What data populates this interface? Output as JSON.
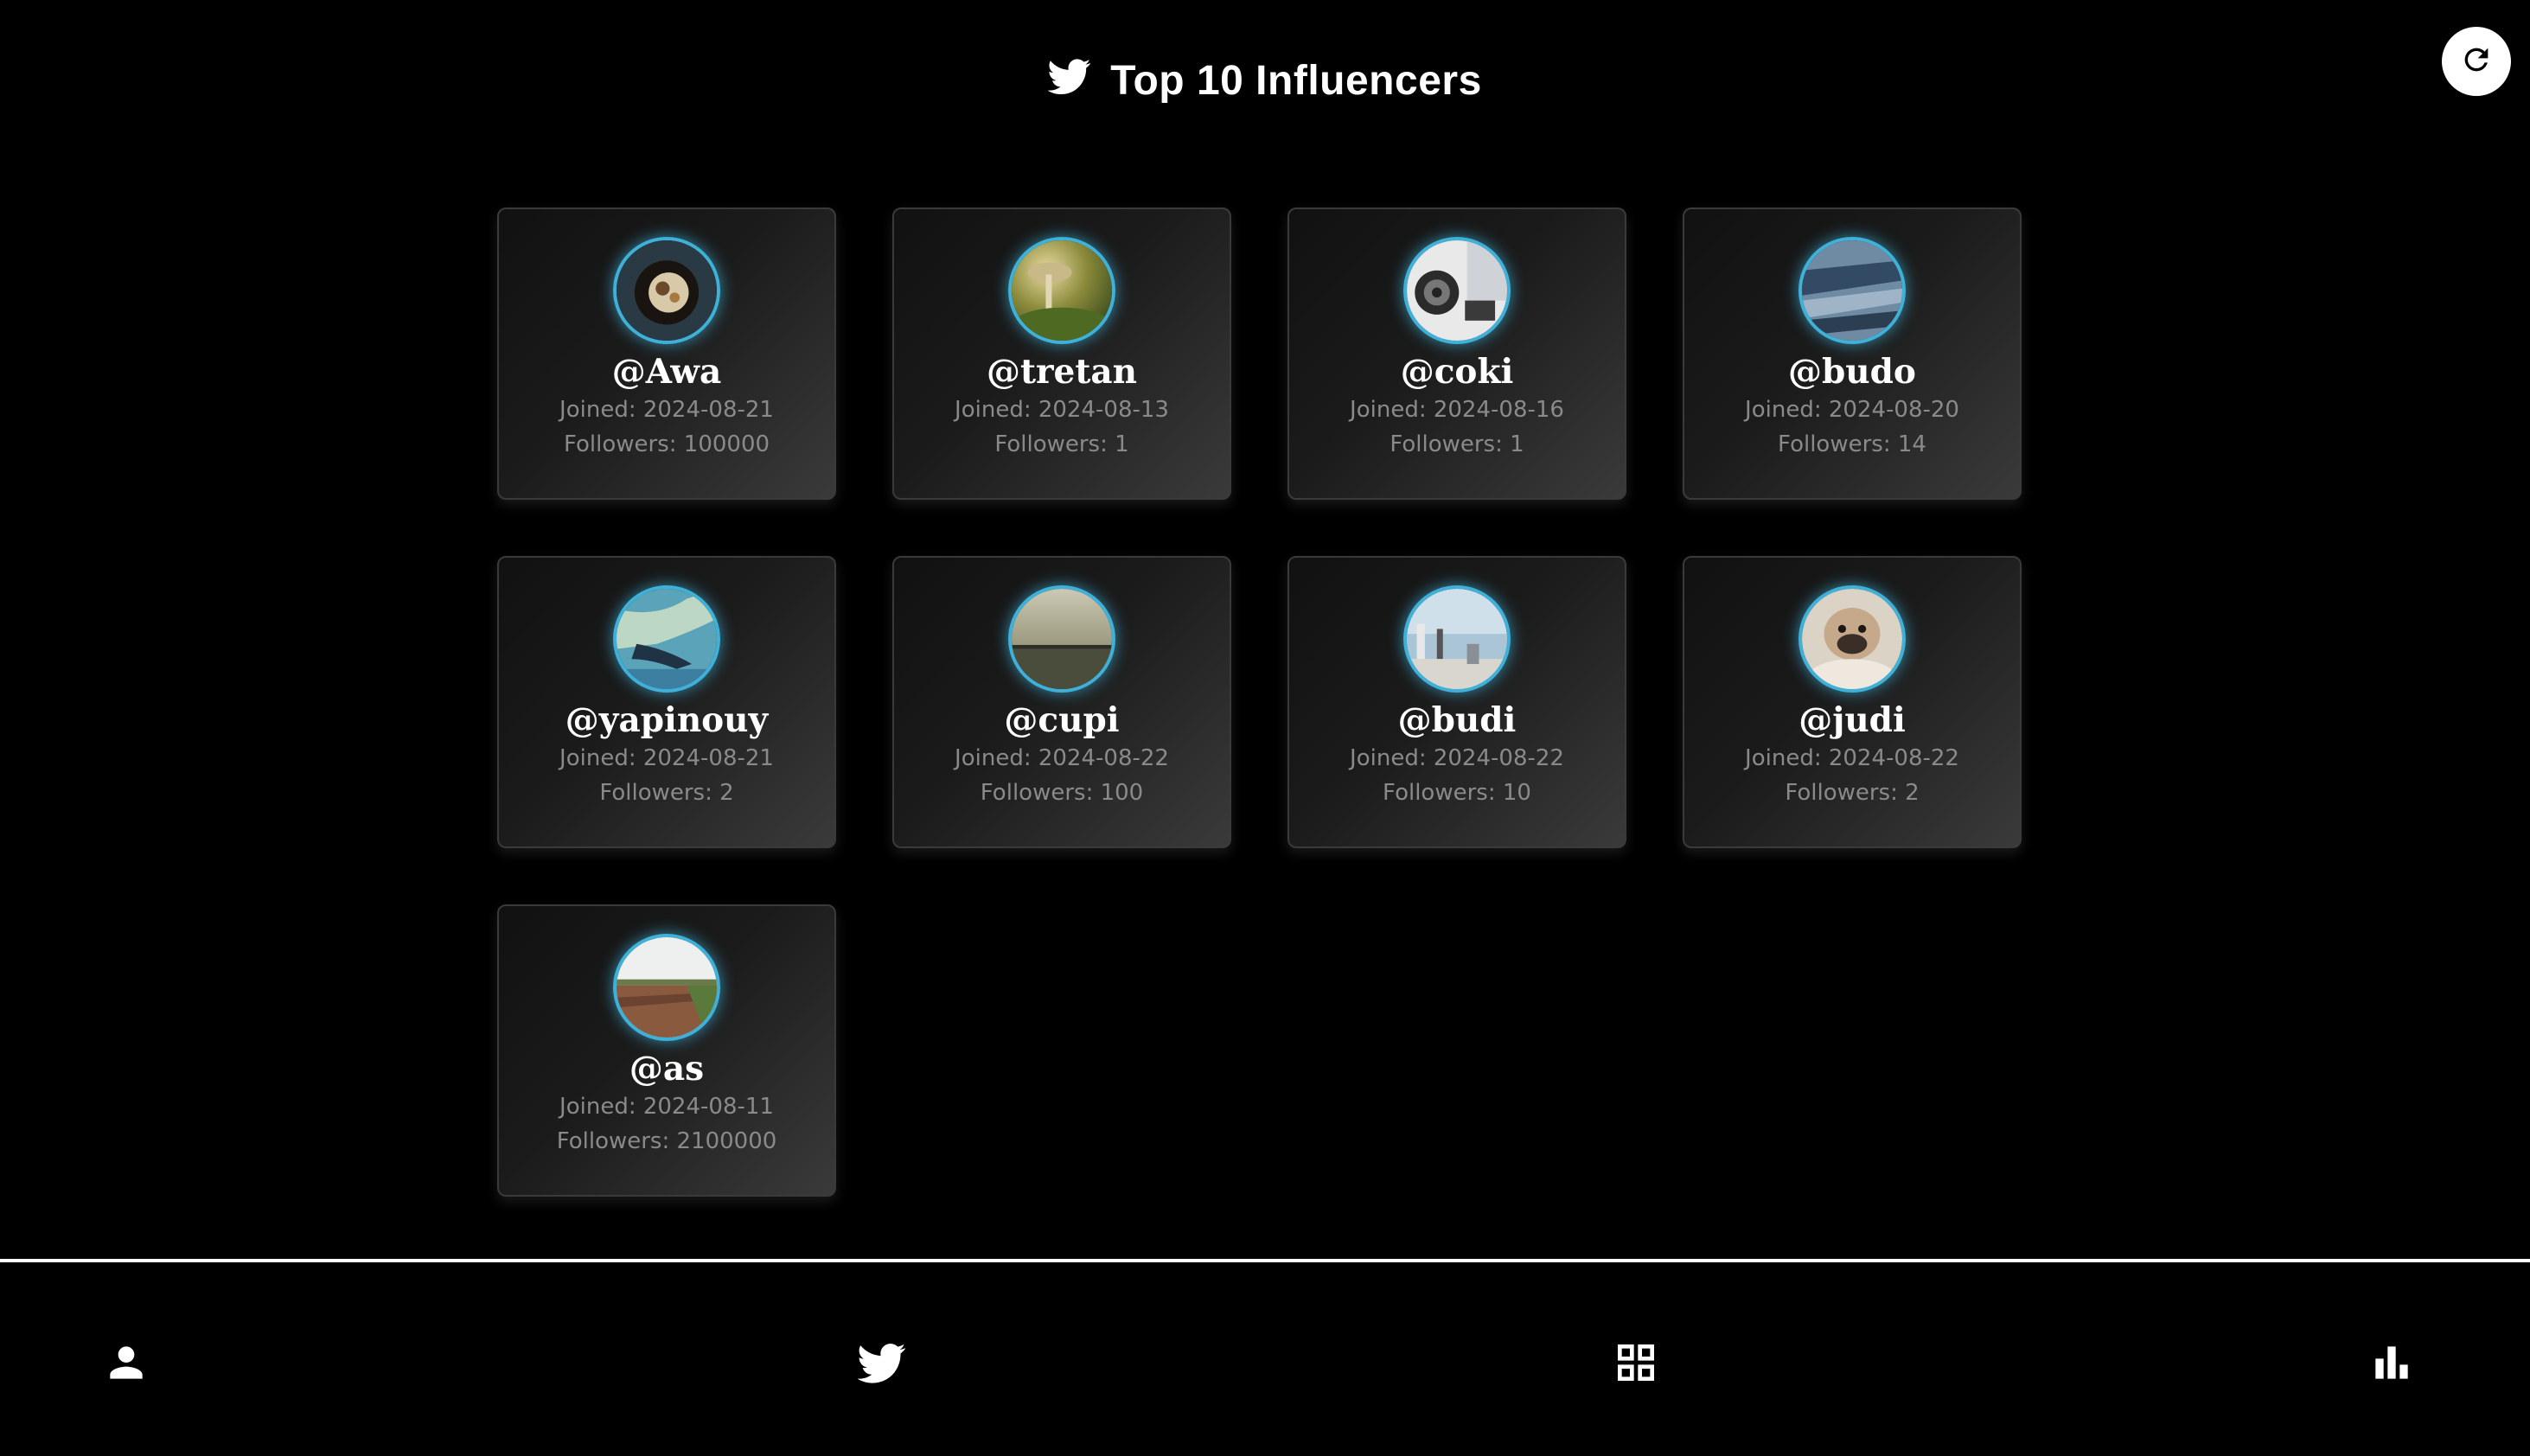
{
  "header": {
    "title": "Top 10 Influencers",
    "icon": "twitter-bird-icon",
    "refresh_icon": "refresh-icon"
  },
  "colors": {
    "background": "#000000",
    "accent_ring": "#3fb0d8",
    "meta_text": "#8a8a8a"
  },
  "influencers": [
    {
      "handle": "@Awa",
      "joined": "Joined: 2024-08-21",
      "followers": "Followers: 100000",
      "avatar": "food-bowl-photo"
    },
    {
      "handle": "@tretan",
      "joined": "Joined: 2024-08-13",
      "followers": "Followers: 1",
      "avatar": "mushroom-photo"
    },
    {
      "handle": "@coki",
      "joined": "Joined: 2024-08-16",
      "followers": "Followers: 1",
      "avatar": "speaker-photo"
    },
    {
      "handle": "@budo",
      "joined": "Joined: 2024-08-20",
      "followers": "Followers: 14",
      "avatar": "aerial-water-photo"
    },
    {
      "handle": "@yapinouy",
      "joined": "Joined: 2024-08-21",
      "followers": "Followers: 2",
      "avatar": "coastline-photo"
    },
    {
      "handle": "@cupi",
      "joined": "Joined: 2024-08-22",
      "followers": "Followers: 100",
      "avatar": "bridge-photo"
    },
    {
      "handle": "@budi",
      "joined": "Joined: 2024-08-22",
      "followers": "Followers: 10",
      "avatar": "pier-photo"
    },
    {
      "handle": "@judi",
      "joined": "Joined: 2024-08-22",
      "followers": "Followers: 2",
      "avatar": "pug-photo"
    },
    {
      "handle": "@as",
      "joined": "Joined: 2024-08-11",
      "followers": "Followers: 2100000",
      "avatar": "field-photo"
    }
  ],
  "bottom_nav": [
    {
      "name": "profile",
      "icon": "person-icon"
    },
    {
      "name": "tweets",
      "icon": "twitter-bird-icon"
    },
    {
      "name": "dashboard",
      "icon": "grid-icon"
    },
    {
      "name": "stats",
      "icon": "bar-chart-icon"
    }
  ]
}
